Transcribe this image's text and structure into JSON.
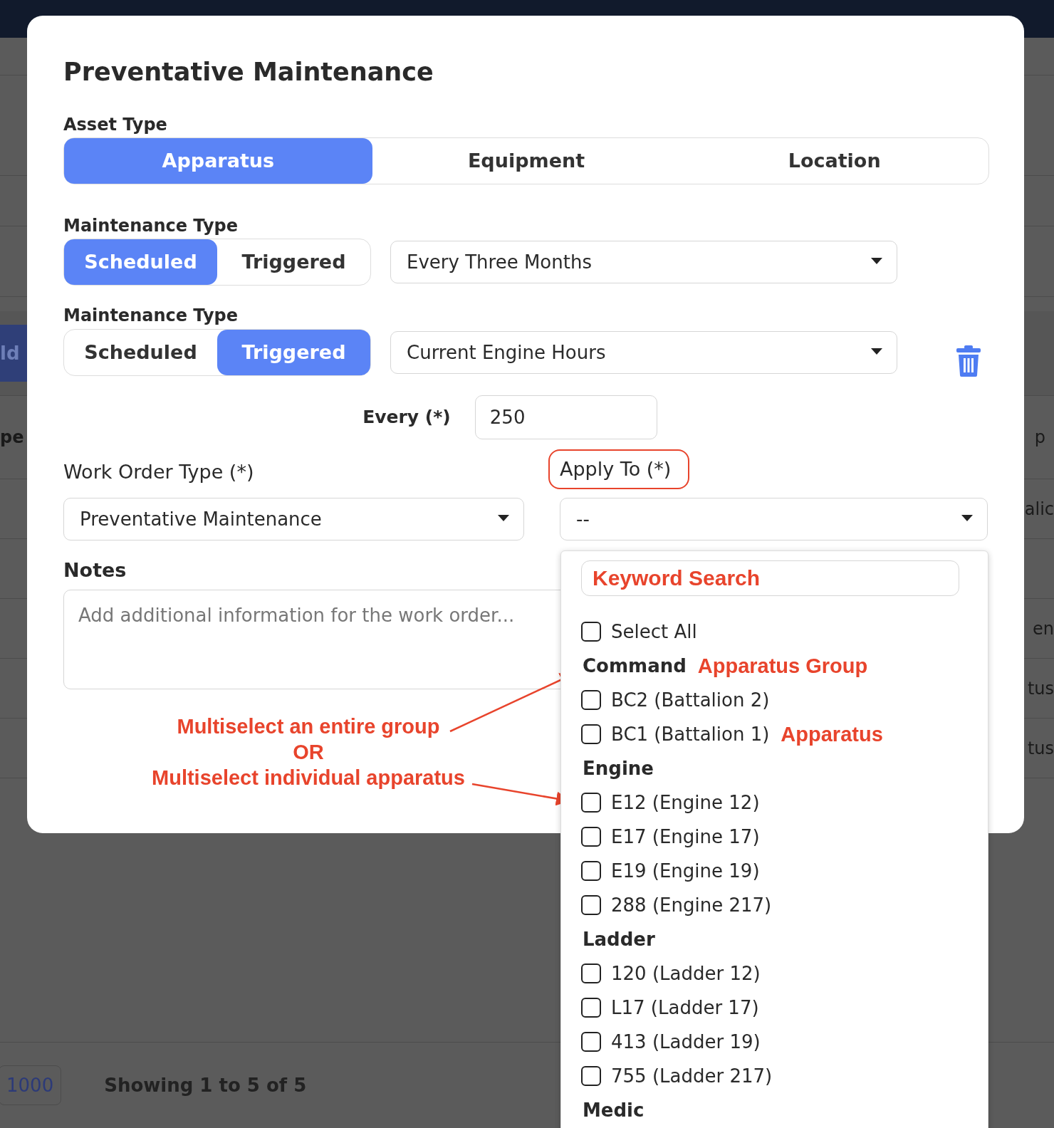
{
  "background": {
    "left_texts": [
      {
        "text": "ld",
        "kind": "button"
      },
      {
        "text": "pe",
        "kind": "heading"
      }
    ],
    "right_texts": [
      "p",
      "alic",
      "en",
      "tus",
      "tus"
    ],
    "page_size": "1000",
    "showing": "Showing 1 to 5 of 5"
  },
  "dialog": {
    "title": "Preventative Maintenance",
    "asset_type": {
      "label": "Asset Type",
      "options": [
        {
          "label": "Apparatus",
          "selected": true
        },
        {
          "label": "Equipment",
          "selected": false
        },
        {
          "label": "Location",
          "selected": false
        }
      ]
    },
    "maintenance_rules": [
      {
        "label": "Maintenance Type",
        "options": [
          {
            "label": "Scheduled",
            "selected": true
          },
          {
            "label": "Triggered",
            "selected": false
          }
        ],
        "dropdown": "Every Three Months",
        "deletable": false
      },
      {
        "label": "Maintenance Type",
        "options": [
          {
            "label": "Scheduled",
            "selected": false
          },
          {
            "label": "Triggered",
            "selected": true
          }
        ],
        "dropdown": "Current Engine Hours",
        "deletable": true,
        "every_label": "Every (*)",
        "every_value": "250"
      }
    ],
    "work_order_type": {
      "label": "Work Order Type (*)",
      "value": "Preventative Maintenance"
    },
    "apply_to": {
      "label": "Apply To (*)",
      "value": "--"
    },
    "notes": {
      "label": "Notes",
      "placeholder": "Add additional information for the work order..."
    }
  },
  "apply_menu": {
    "search_placeholder": "Keyword Search",
    "items": [
      {
        "kind": "option",
        "label": "Select All",
        "checked": false
      },
      {
        "kind": "group",
        "label": "Command",
        "annotation": "Apparatus Group"
      },
      {
        "kind": "option",
        "label": "BC2 (Battalion 2)",
        "checked": false
      },
      {
        "kind": "option",
        "label": "BC1 (Battalion 1)",
        "checked": false,
        "annotation": "Apparatus"
      },
      {
        "kind": "group",
        "label": "Engine"
      },
      {
        "kind": "option",
        "label": "E12 (Engine 12)",
        "checked": false
      },
      {
        "kind": "option",
        "label": "E17 (Engine 17)",
        "checked": false
      },
      {
        "kind": "option",
        "label": "E19 (Engine 19)",
        "checked": false
      },
      {
        "kind": "option",
        "label": "288 (Engine 217)",
        "checked": false
      },
      {
        "kind": "group",
        "label": "Ladder"
      },
      {
        "kind": "option",
        "label": "120 (Ladder 12)",
        "checked": false
      },
      {
        "kind": "option",
        "label": "L17 (Ladder 17)",
        "checked": false
      },
      {
        "kind": "option",
        "label": "413 (Ladder 19)",
        "checked": false
      },
      {
        "kind": "option",
        "label": "755 (Ladder 217)",
        "checked": false
      },
      {
        "kind": "group",
        "label": "Medic"
      }
    ]
  },
  "annotations": [
    "Multiselect an entire group",
    "OR",
    "Multiselect individual apparatus"
  ]
}
